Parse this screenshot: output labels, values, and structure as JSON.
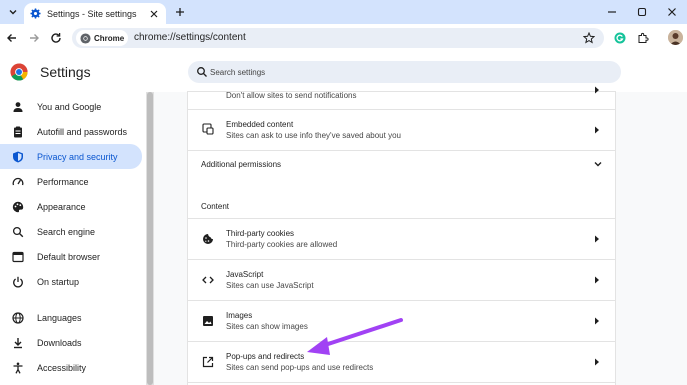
{
  "tab": {
    "title": "Settings - Site settings"
  },
  "omnibox": {
    "chip": "Chrome",
    "url": "chrome://settings/content"
  },
  "header": {
    "title": "Settings",
    "search_placeholder": "Search settings"
  },
  "sidebar": {
    "items": [
      {
        "label": "You and Google",
        "icon": "person-icon"
      },
      {
        "label": "Autofill and passwords",
        "icon": "clipboard-icon"
      },
      {
        "label": "Privacy and security",
        "icon": "shield-icon"
      },
      {
        "label": "Performance",
        "icon": "speedometer-icon"
      },
      {
        "label": "Appearance",
        "icon": "palette-icon"
      },
      {
        "label": "Search engine",
        "icon": "search-icon"
      },
      {
        "label": "Default browser",
        "icon": "browser-icon"
      },
      {
        "label": "On startup",
        "icon": "power-icon"
      },
      {
        "label": "Languages",
        "icon": "globe-icon"
      },
      {
        "label": "Downloads",
        "icon": "download-icon"
      },
      {
        "label": "Accessibility",
        "icon": "accessibility-icon"
      }
    ]
  },
  "content": {
    "notifications_sub": "Don't allow sites to send notifications",
    "embedded": {
      "title": "Embedded content",
      "sub": "Sites can ask to use info they've saved about you"
    },
    "additional_permissions": "Additional permissions",
    "section_content": "Content",
    "cookies": {
      "title": "Third-party cookies",
      "sub": "Third-party cookies are allowed"
    },
    "javascript": {
      "title": "JavaScript",
      "sub": "Sites can use JavaScript"
    },
    "images": {
      "title": "Images",
      "sub": "Sites can show images"
    },
    "popups": {
      "title": "Pop-ups and redirects",
      "sub": "Sites can send pop-ups and use redirects"
    }
  },
  "colors": {
    "tabstrip": "#d3e3fd",
    "accent": "#0b57d0",
    "annotation_arrow": "#a142f4"
  }
}
